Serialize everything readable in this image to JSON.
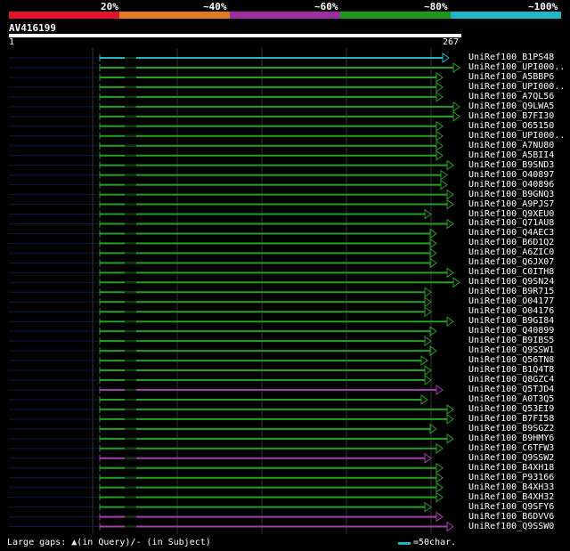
{
  "legend": {
    "labels": [
      "20%",
      "~40%",
      "~60%",
      "~80%",
      "~100%"
    ],
    "colors": [
      "#e0142c",
      "#e07a1e",
      "#9b2ea0",
      "#1c9a1c",
      "#1fb6c8"
    ]
  },
  "query": {
    "title": "AV416199",
    "start": "1",
    "end": "267"
  },
  "hit_colors": {
    "green": "#23a023",
    "magenta": "#a63cb0",
    "cyan": "#1fb6c8",
    "dark": "#0a1a4a"
  },
  "hits": [
    {
      "label": "UniRef100_B1PS48",
      "color": "cyan",
      "ext": 0
    },
    {
      "label": "UniRef100_UPI000..",
      "color": "green",
      "ext": 12
    },
    {
      "label": "UniRef100_A5BBP6",
      "color": "green",
      "ext": -7
    },
    {
      "label": "UniRef100_UPI000..",
      "color": "green",
      "ext": -7
    },
    {
      "label": "UniRef100_A7QL56",
      "color": "green",
      "ext": -7
    },
    {
      "label": "UniRef100_Q9LWA5",
      "color": "green",
      "ext": 12
    },
    {
      "label": "UniRef100_B7FI30",
      "color": "green",
      "ext": 12
    },
    {
      "label": "UniRef100_O65150",
      "color": "green",
      "ext": -7
    },
    {
      "label": "UniRef100_UPI000..",
      "color": "green",
      "ext": -7
    },
    {
      "label": "UniRef100_A7NU80",
      "color": "green",
      "ext": -7
    },
    {
      "label": "UniRef100_A5BII4",
      "color": "green",
      "ext": -7
    },
    {
      "label": "UniRef100_B9SND3",
      "color": "green",
      "ext": 5
    },
    {
      "label": "UniRef100_O40897",
      "color": "green",
      "ext": -2
    },
    {
      "label": "UniRef100_O40896",
      "color": "green",
      "ext": -2
    },
    {
      "label": "UniRef100_B9GNQ3",
      "color": "green",
      "ext": 5
    },
    {
      "label": "UniRef100_A9PJS7",
      "color": "green",
      "ext": 5
    },
    {
      "label": "UniRef100_Q9XEU0",
      "color": "green",
      "ext": -20
    },
    {
      "label": "UniRef100_Q71AU8",
      "color": "green",
      "ext": 5
    },
    {
      "label": "UniRef100_Q4AEC3",
      "color": "green",
      "ext": -14
    },
    {
      "label": "UniRef100_B6D1Q2",
      "color": "green",
      "ext": -14
    },
    {
      "label": "UniRef100_A6ZIC0",
      "color": "green",
      "ext": -14
    },
    {
      "label": "UniRef100_Q6JX07",
      "color": "green",
      "ext": -14
    },
    {
      "label": "UniRef100_C0ITH8",
      "color": "green",
      "ext": 5
    },
    {
      "label": "UniRef100_Q9SN24",
      "color": "green",
      "ext": 12
    },
    {
      "label": "UniRef100_B9R715",
      "color": "green",
      "ext": -20
    },
    {
      "label": "UniRef100_O04177",
      "color": "green",
      "ext": -20
    },
    {
      "label": "UniRef100_O04176",
      "color": "green",
      "ext": -20
    },
    {
      "label": "UniRef100_B9GI84",
      "color": "green",
      "ext": 5
    },
    {
      "label": "UniRef100_Q40899",
      "color": "green",
      "ext": -14
    },
    {
      "label": "UniRef100_B9IBS5",
      "color": "green",
      "ext": -20
    },
    {
      "label": "UniRef100_Q9SSW1",
      "color": "green",
      "ext": -14
    },
    {
      "label": "UniRef100_Q56TN8",
      "color": "green",
      "ext": -24
    },
    {
      "label": "UniRef100_B1Q4T8",
      "color": "green",
      "ext": -20
    },
    {
      "label": "UniRef100_Q8GZC4",
      "color": "green",
      "ext": -20
    },
    {
      "label": "UniRef100_Q5TJD4",
      "color": "magenta",
      "ext": -7
    },
    {
      "label": "UniRef100_A0T3Q5",
      "color": "green",
      "ext": -24
    },
    {
      "label": "UniRef100_Q53EI9",
      "color": "green",
      "ext": 5
    },
    {
      "label": "UniRef100_B7FI58",
      "color": "green",
      "ext": 5
    },
    {
      "label": "UniRef100_B9SGZ2",
      "color": "green",
      "ext": -14
    },
    {
      "label": "UniRef100_B9HMY6",
      "color": "green",
      "ext": 5
    },
    {
      "label": "UniRef100_C6TFW3",
      "color": "green",
      "ext": -7
    },
    {
      "label": "UniRef100_Q9SSW2",
      "color": "magenta",
      "ext": -20
    },
    {
      "label": "UniRef100_B4XH18",
      "color": "green",
      "ext": -7
    },
    {
      "label": "UniRef100_P93166",
      "color": "green",
      "ext": -7
    },
    {
      "label": "UniRef100_B4XH33",
      "color": "green",
      "ext": -7
    },
    {
      "label": "UniRef100_B4XH32",
      "color": "green",
      "ext": -7
    },
    {
      "label": "UniRef100_Q9SFY6",
      "color": "green",
      "ext": -20
    },
    {
      "label": "UniRef100_B6DVV6",
      "color": "magenta",
      "ext": -7
    },
    {
      "label": "UniRef100_Q9SSW0",
      "color": "magenta",
      "ext": 5
    }
  ],
  "footer": {
    "gaps_text": "Large gaps: ▲(in Query)/- (in Subject)",
    "scale_text": "=50char."
  }
}
